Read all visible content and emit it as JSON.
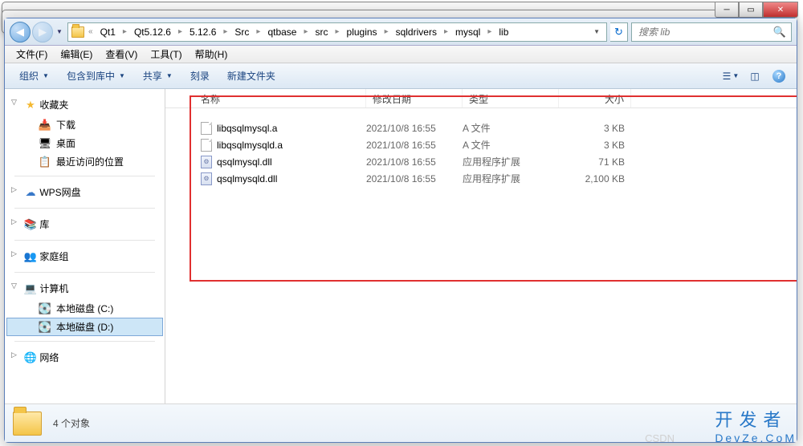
{
  "breadcrumbs": [
    "Qt1",
    "Qt5.12.6",
    "5.12.6",
    "Src",
    "qtbase",
    "src",
    "plugins",
    "sqldrivers",
    "mysql",
    "lib"
  ],
  "search": {
    "placeholder": "搜索 lib"
  },
  "menubar": {
    "file": "文件(F)",
    "edit": "编辑(E)",
    "view": "查看(V)",
    "tools": "工具(T)",
    "help": "帮助(H)"
  },
  "toolbar": {
    "organize": "组织",
    "include": "包含到库中",
    "share": "共享",
    "burn": "刻录",
    "newfolder": "新建文件夹"
  },
  "sidebar": {
    "favorites": {
      "header": "收藏夹",
      "downloads": "下载",
      "desktop": "桌面",
      "recent": "最近访问的位置"
    },
    "wps": "WPS网盘",
    "libraries": "库",
    "homegroup": "家庭组",
    "computer": {
      "header": "计算机",
      "drive_c": "本地磁盘 (C:)",
      "drive_d": "本地磁盘 (D:)"
    },
    "network": "网络"
  },
  "columns": {
    "name": "名称",
    "date": "修改日期",
    "type": "类型",
    "size": "大小"
  },
  "files": [
    {
      "name": "libqsqlmysql.a",
      "date": "2021/10/8 16:55",
      "type": "A 文件",
      "size": "3 KB",
      "icon": "a"
    },
    {
      "name": "libqsqlmysqld.a",
      "date": "2021/10/8 16:55",
      "type": "A 文件",
      "size": "3 KB",
      "icon": "a"
    },
    {
      "name": "qsqlmysql.dll",
      "date": "2021/10/8 16:55",
      "type": "应用程序扩展",
      "size": "71 KB",
      "icon": "dll"
    },
    {
      "name": "qsqlmysqld.dll",
      "date": "2021/10/8 16:55",
      "type": "应用程序扩展",
      "size": "2,100 KB",
      "icon": "dll"
    }
  ],
  "status": {
    "count": "4 个对象"
  },
  "watermark": {
    "line1": "开 发 者",
    "line2": "DevZe.CoM"
  }
}
